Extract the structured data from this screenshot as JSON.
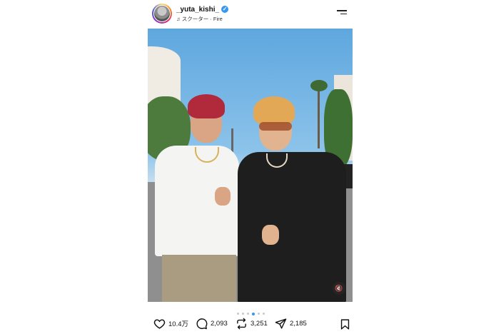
{
  "header": {
    "username": "_yuta_kishi_",
    "verified": true,
    "music_note_icon": "music-note-icon",
    "music": "スクーター · Fire"
  },
  "carousel": {
    "total_slides": 6,
    "active_slide": 4
  },
  "actions": {
    "likes": "10.4万",
    "comments": "2,093",
    "reposts": "3,251",
    "shares": "2,185"
  },
  "colors": {
    "verified_blue": "#3897f0",
    "active_dot": "#3897f0"
  }
}
